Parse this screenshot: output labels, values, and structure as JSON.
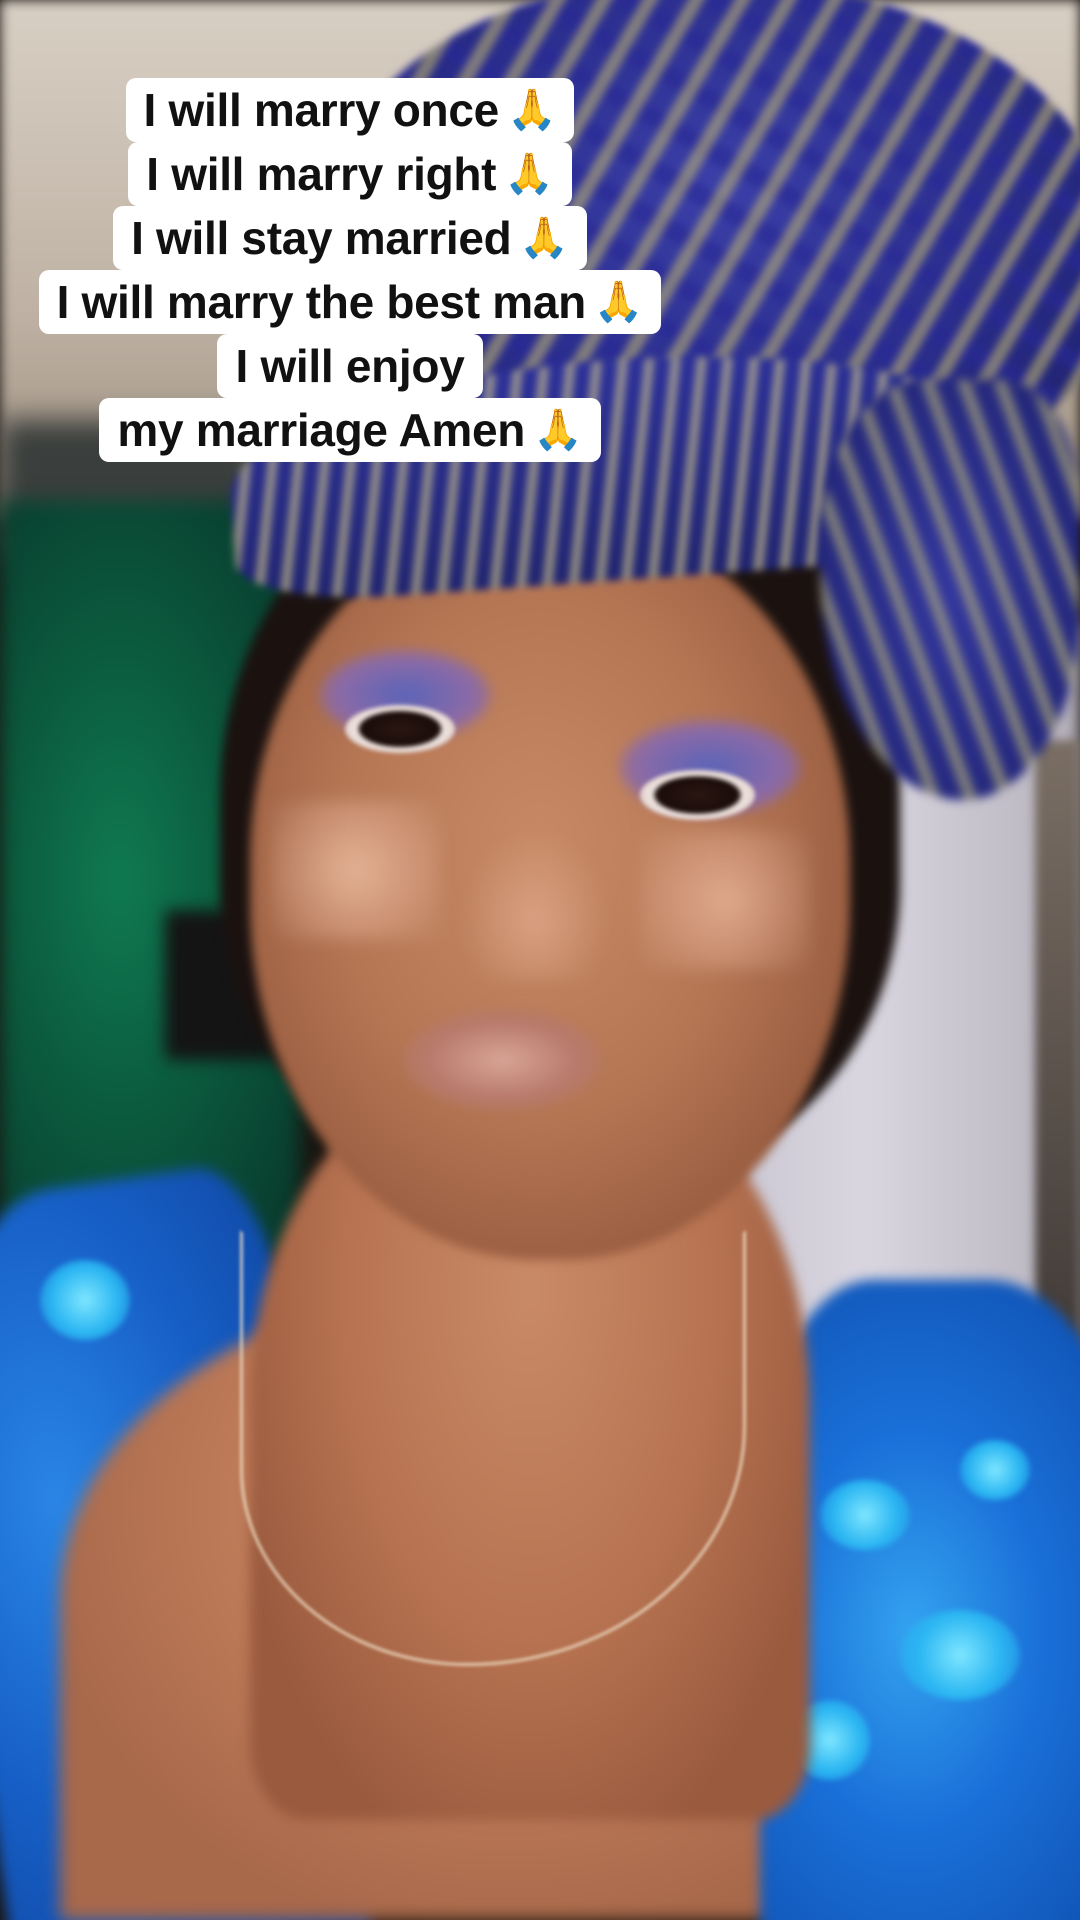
{
  "caption": {
    "lines": [
      {
        "text": "I will marry once",
        "emoji": "🙏"
      },
      {
        "text": "I will marry right",
        "emoji": "🙏"
      },
      {
        "text": "I will stay married",
        "emoji": "🙏"
      },
      {
        "text": "I will marry the best man",
        "emoji": "🙏"
      },
      {
        "text": "I will enjoy",
        "emoji": ""
      },
      {
        "text": "my marriage Amen",
        "emoji": "🙏"
      }
    ]
  },
  "colors": {
    "caption_bg": "#ffffff",
    "caption_text": "#111111",
    "gele_blue": "#2a2d8c",
    "gown_blue": "#1a70d8"
  }
}
